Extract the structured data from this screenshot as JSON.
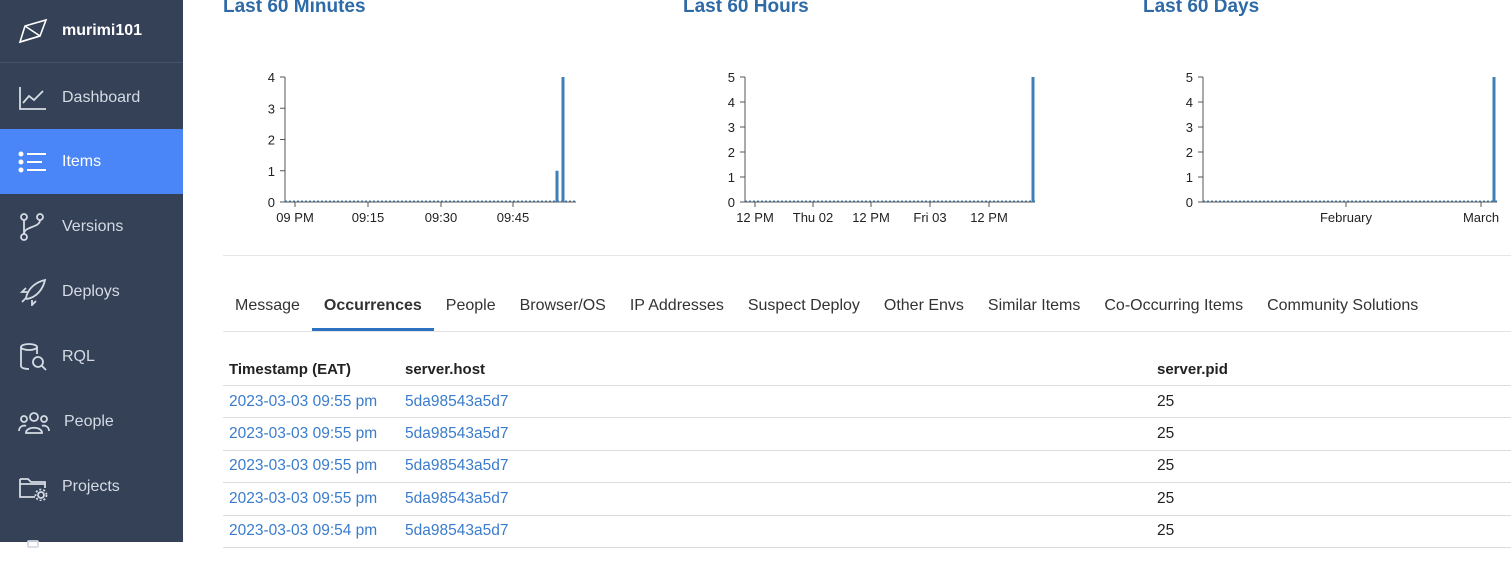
{
  "sidebar": {
    "user": "murimi101",
    "items": [
      {
        "label": "Dashboard",
        "icon": "chart-line-icon"
      },
      {
        "label": "Items",
        "icon": "list-icon",
        "active": true
      },
      {
        "label": "Versions",
        "icon": "branch-icon"
      },
      {
        "label": "Deploys",
        "icon": "rocket-icon"
      },
      {
        "label": "RQL",
        "icon": "database-search-icon"
      },
      {
        "label": "People",
        "icon": "people-icon"
      },
      {
        "label": "Projects",
        "icon": "folder-gear-icon"
      }
    ]
  },
  "chart_data": [
    {
      "type": "bar",
      "title": "Last 60 Minutes",
      "ylim": [
        0,
        4
      ],
      "yticks": [
        0,
        1,
        2,
        3,
        4
      ],
      "x_ticks": [
        "09 PM",
        "09:15",
        "09:30",
        "09:45"
      ],
      "bars": [
        {
          "x": "09:54",
          "value": 1
        },
        {
          "x": "09:55",
          "value": 4
        }
      ]
    },
    {
      "type": "bar",
      "title": "Last 60 Hours",
      "ylim": [
        0,
        5
      ],
      "yticks": [
        0,
        1,
        2,
        3,
        4,
        5
      ],
      "x_ticks": [
        "12 PM",
        "Thu 02",
        "12 PM",
        "Fri 03",
        "12 PM"
      ],
      "bars": [
        {
          "x": "Fri 03 09 PM",
          "value": 5
        }
      ]
    },
    {
      "type": "bar",
      "title": "Last 60 Days",
      "ylim": [
        0,
        5
      ],
      "yticks": [
        0,
        1,
        2,
        3,
        4,
        5
      ],
      "x_ticks": [
        "February",
        "March"
      ],
      "bars": [
        {
          "x": "March 03",
          "value": 5
        }
      ]
    }
  ],
  "tabs": [
    "Message",
    "Occurrences",
    "People",
    "Browser/OS",
    "IP Addresses",
    "Suspect Deploy",
    "Other Envs",
    "Similar Items",
    "Co-Occurring Items",
    "Community Solutions"
  ],
  "active_tab": "Occurrences",
  "table": {
    "headers": {
      "timestamp": "Timestamp (EAT)",
      "host": "server.host",
      "pid": "server.pid"
    },
    "rows": [
      {
        "timestamp": "2023-03-03 09:55 pm",
        "host": "5da98543a5d7",
        "pid": "25"
      },
      {
        "timestamp": "2023-03-03 09:55 pm",
        "host": "5da98543a5d7",
        "pid": "25"
      },
      {
        "timestamp": "2023-03-03 09:55 pm",
        "host": "5da98543a5d7",
        "pid": "25"
      },
      {
        "timestamp": "2023-03-03 09:55 pm",
        "host": "5da98543a5d7",
        "pid": "25"
      },
      {
        "timestamp": "2023-03-03 09:54 pm",
        "host": "5da98543a5d7",
        "pid": "25"
      }
    ]
  },
  "colors": {
    "sidebar_bg": "#344156",
    "active": "#4a86f7",
    "bar": "#3f7fb8",
    "title": "#2d6aa6",
    "link": "#3a7ccc"
  }
}
